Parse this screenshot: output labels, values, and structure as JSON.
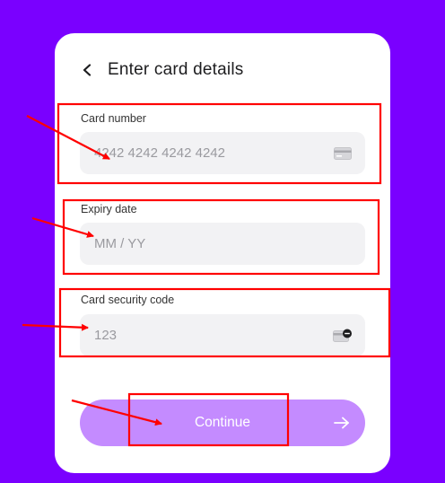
{
  "colors": {
    "background": "#7a00ff",
    "card": "#ffffff",
    "field": "#f2f2f4",
    "button": "#c48bff",
    "annotation": "#ff0000"
  },
  "header": {
    "back_icon": "chevron-left-icon",
    "title": "Enter card details"
  },
  "form": {
    "card_number": {
      "label": "Card number",
      "placeholder": "4242 4242 4242 4242",
      "value": "",
      "icon": "credit-card-icon"
    },
    "expiry": {
      "label": "Expiry date",
      "placeholder": "MM / YY",
      "value": ""
    },
    "cvc": {
      "label": "Card security code",
      "placeholder": "123",
      "value": "",
      "icon": "card-cvc-icon"
    }
  },
  "continue_button": {
    "label": "Continue",
    "icon": "arrow-right-icon"
  }
}
